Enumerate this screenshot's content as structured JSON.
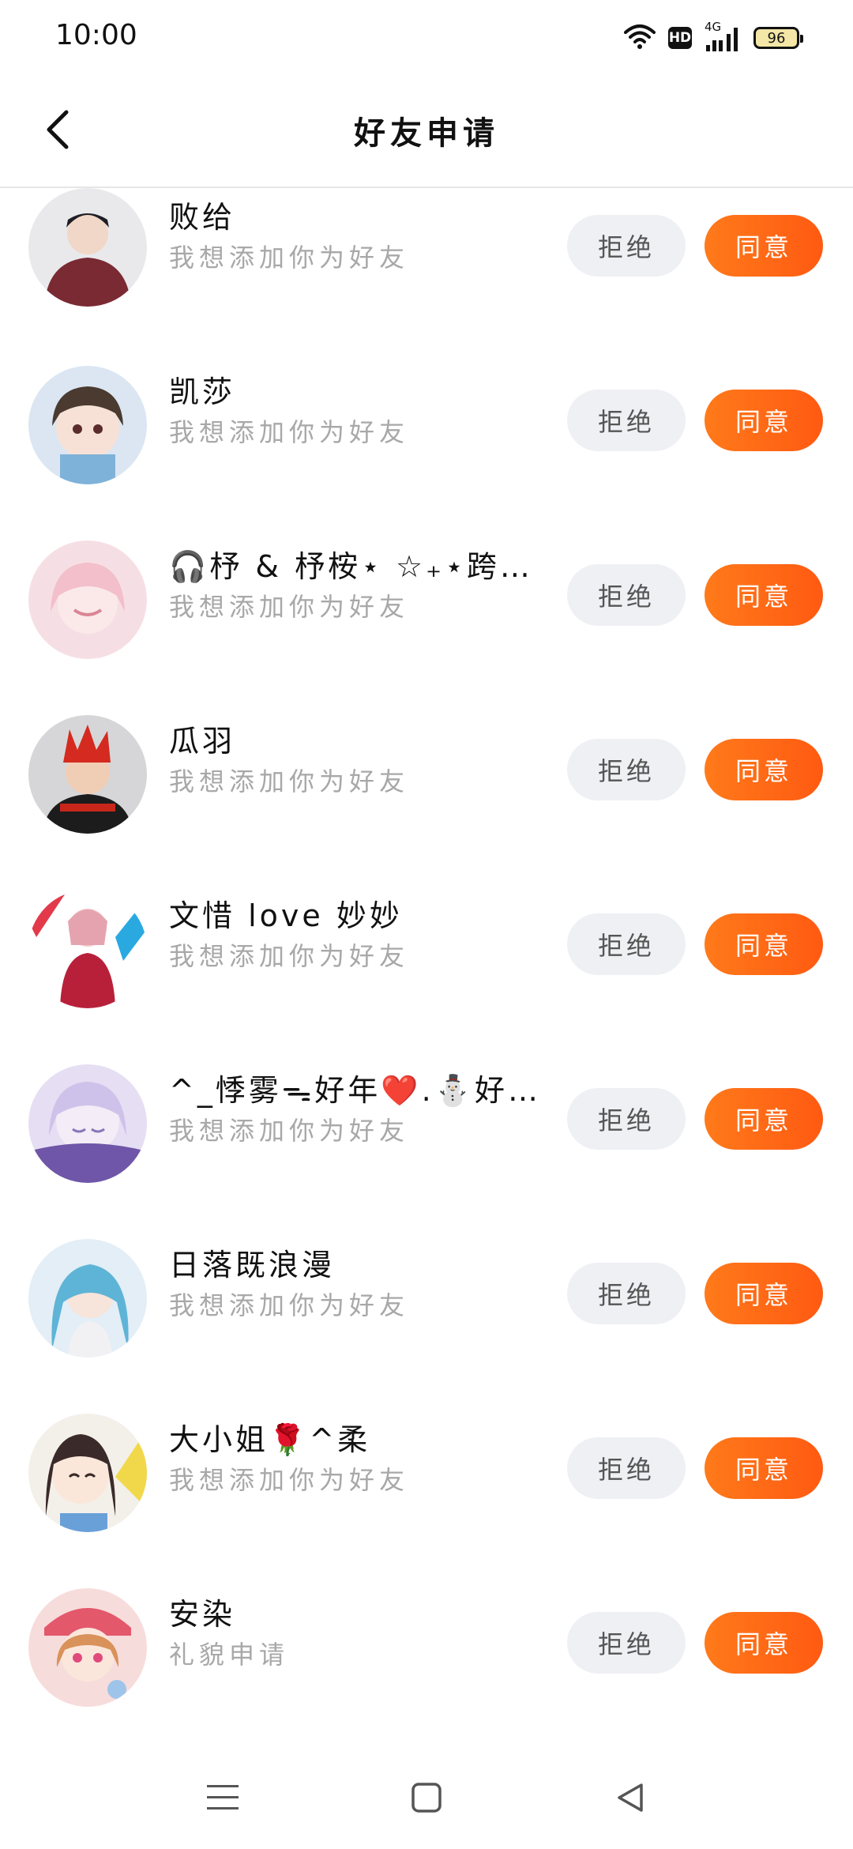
{
  "status_bar": {
    "time": "10:00",
    "hd": "HD",
    "network": "4G",
    "battery": "96",
    "icons": [
      "wifi-icon",
      "hd-icon",
      "signal-icon",
      "battery-icon"
    ]
  },
  "header": {
    "title": "好友申请",
    "back_icon": "chevron-left-icon"
  },
  "buttons": {
    "reject_label": "拒绝",
    "accept_label": "同意"
  },
  "colors": {
    "accent": "#ff6314",
    "reject_bg": "#eef0f4",
    "message_gray": "#a8a8a8"
  },
  "requests": [
    {
      "name": "败给",
      "message": "我想添加你为好友"
    },
    {
      "name": "凯莎",
      "message": "我想添加你为好友"
    },
    {
      "name": "🎧杼 & 杼桉⋆ ☆₊⋆跨年 ...",
      "message": "我想添加你为好友"
    },
    {
      "name": "瓜羽",
      "message": "我想添加你为好友"
    },
    {
      "name": "文惜 love 妙妙",
      "message": "我想添加你为好友"
    },
    {
      "name": "^_悸雾ᯓ好年❤️.⛄好蒽",
      "message": "我想添加你为好友"
    },
    {
      "name": "日落既浪漫",
      "message": "我想添加你为好友"
    },
    {
      "name": "大小姐🌹^柔",
      "message": "我想添加你为好友"
    },
    {
      "name": "安染",
      "message": "礼貌申请"
    }
  ],
  "nav": {
    "icons": [
      "menu-icon",
      "home-icon",
      "back-triangle-icon"
    ]
  }
}
